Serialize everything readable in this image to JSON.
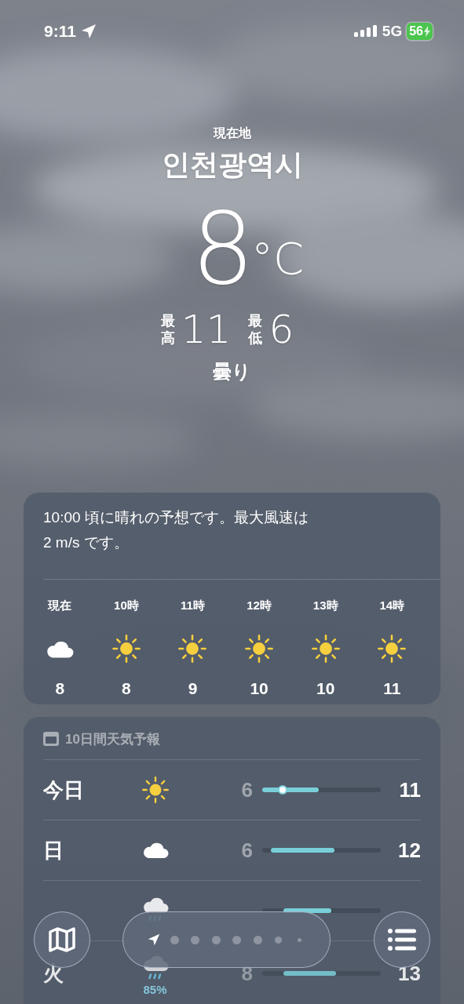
{
  "status_bar": {
    "time": "9:11",
    "network": "5G",
    "battery": "56"
  },
  "header": {
    "location_label": "現在地",
    "city": "인천광역시",
    "temperature": "8",
    "unit": "°C",
    "high_label": "最高",
    "high": "11",
    "low_label": "最低",
    "low": "6",
    "condition": "曇り"
  },
  "hourly": {
    "summary": "10:00 頃に晴れの予想です。最大風速は 2 m/s です。",
    "hours": [
      {
        "time": "現在",
        "kind": "cloud",
        "temp": "8"
      },
      {
        "time": "10時",
        "kind": "sun",
        "temp": "8"
      },
      {
        "time": "11時",
        "kind": "sun",
        "temp": "9"
      },
      {
        "time": "12時",
        "kind": "sun",
        "temp": "10"
      },
      {
        "time": "13時",
        "kind": "sun",
        "temp": "10"
      },
      {
        "time": "14時",
        "kind": "sun",
        "temp": "11"
      }
    ]
  },
  "daily": {
    "title": "10日間天気予報",
    "days": [
      {
        "day": "今日",
        "kind": "sun",
        "low": "6",
        "high": "11",
        "current": {
          "level": 0.17
        }
      },
      {
        "day": "日",
        "kind": "cloud",
        "low": "6",
        "high": "12"
      },
      {
        "kind": "cloud_rain"
      },
      {
        "day": "火",
        "kind": "cloud_rain",
        "precip": "85%",
        "low": "8",
        "high": "13"
      }
    ]
  },
  "toolbar": {
    "pages": [
      {
        "kind": "location",
        "selected": true
      },
      {
        "kind": "dot",
        "selected": false
      },
      {
        "kind": "dot",
        "selected": false
      },
      {
        "kind": "dot",
        "selected": false
      },
      {
        "kind": "dot",
        "selected": false
      },
      {
        "kind": "dot",
        "selected": false
      },
      {
        "kind": "small",
        "selected": false
      },
      {
        "kind": "tiny",
        "selected": false
      }
    ]
  }
}
